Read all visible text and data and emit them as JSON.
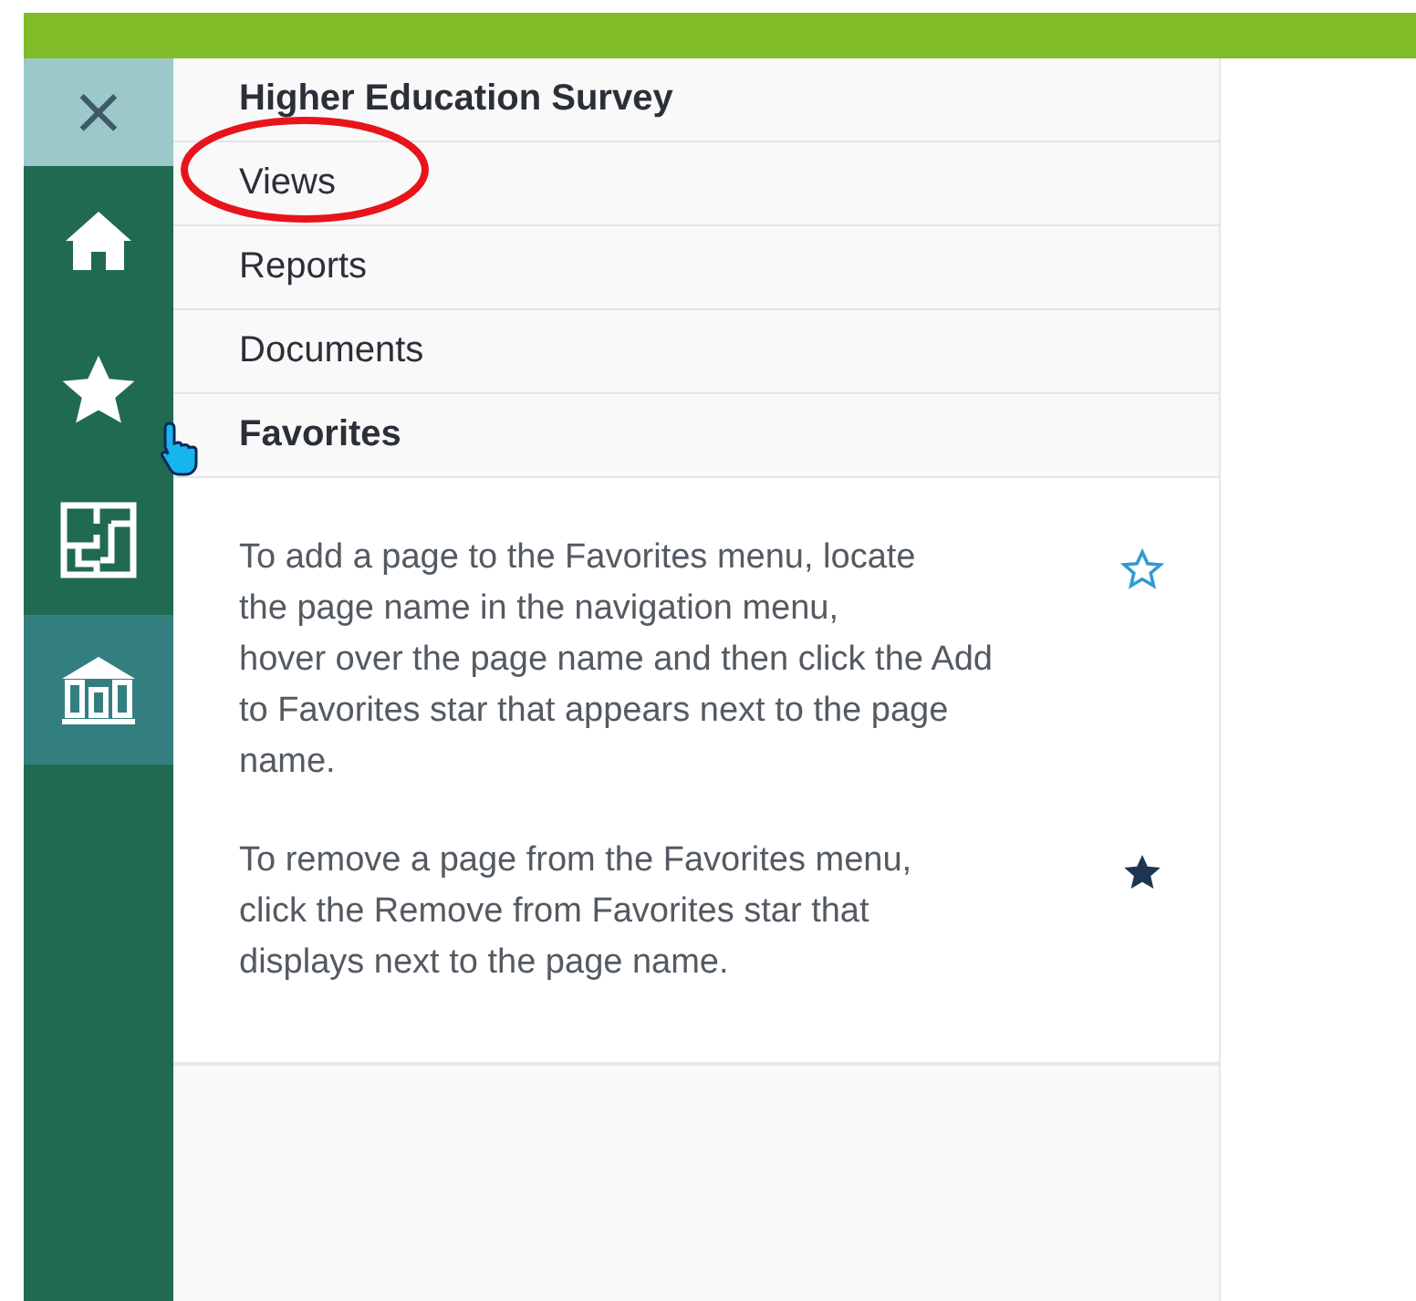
{
  "rail": {
    "close": {
      "label": "×"
    },
    "items": [
      {
        "kind": "home",
        "selected": false
      },
      {
        "kind": "star",
        "selected": false
      },
      {
        "kind": "floorplan",
        "selected": false
      },
      {
        "kind": "building",
        "selected": true
      }
    ]
  },
  "menu": {
    "items": [
      {
        "label": "Higher Education Survey",
        "kind": "header",
        "annotated": false
      },
      {
        "label": "Views",
        "kind": "link",
        "annotated": true
      },
      {
        "label": "Reports",
        "kind": "link",
        "annotated": false
      },
      {
        "label": "Documents",
        "kind": "link",
        "annotated": false
      },
      {
        "label": "Favorites",
        "kind": "header",
        "annotated": false
      }
    ]
  },
  "favorites_help": [
    {
      "lines": [
        "To add a page to the Favorites menu, locate",
        "the page name in the navigation menu,",
        "hover over the page name and then click the Add",
        "to Favorites star that appears next to the page",
        "name."
      ],
      "kind": "add"
    },
    {
      "lines": [
        "To remove a page from the Favorites menu,",
        "click the Remove from Favorites star that",
        "displays next to the page name."
      ],
      "kind": "remove"
    }
  ]
}
